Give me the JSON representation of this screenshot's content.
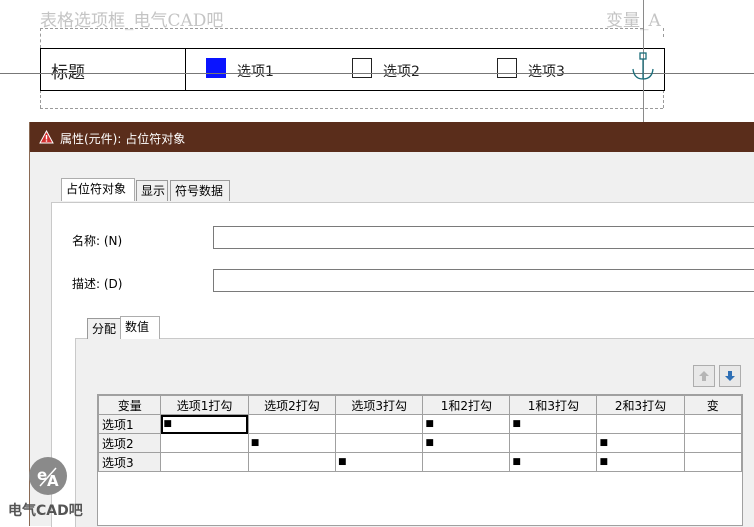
{
  "canvas": {
    "title": "表格选项框_电气CAD吧",
    "variable": "变量_A",
    "row_title": "标题",
    "options": [
      {
        "label": "选项1",
        "checked": true
      },
      {
        "label": "选项2",
        "checked": false
      },
      {
        "label": "选项3",
        "checked": false
      }
    ],
    "check_color": "#0a14ff"
  },
  "dialog": {
    "title": "属性(元件): 占位符对象",
    "titlebar_color": "#5a2d1b",
    "icon": "warning-icon",
    "tabs": [
      "占位符对象",
      "显示",
      "符号数据"
    ],
    "fields": {
      "name_label": "名称: (N)",
      "name_value": "",
      "desc_label": "描述: (D)",
      "desc_value": ""
    },
    "subtabs": [
      "分配",
      "数值"
    ],
    "up_icon": "arrow-up-icon",
    "down_icon": "arrow-down-icon",
    "table": {
      "columns": [
        "变量",
        "选项1打勾",
        "选项2打勾",
        "选项3打勾",
        "1和2打勾",
        "1和3打勾",
        "2和3打勾",
        "变"
      ],
      "rows": [
        {
          "name": "选项1",
          "cells": [
            "■",
            "",
            "",
            "■",
            "■",
            "",
            ""
          ]
        },
        {
          "name": "选项2",
          "cells": [
            "",
            "■",
            "",
            "■",
            "",
            "■",
            ""
          ]
        },
        {
          "name": "选项3",
          "cells": [
            "",
            "",
            "■",
            "",
            "■",
            "■",
            ""
          ]
        }
      ]
    }
  },
  "watermark": {
    "icon": "ea-logo-icon",
    "text": "电气CAD吧"
  }
}
